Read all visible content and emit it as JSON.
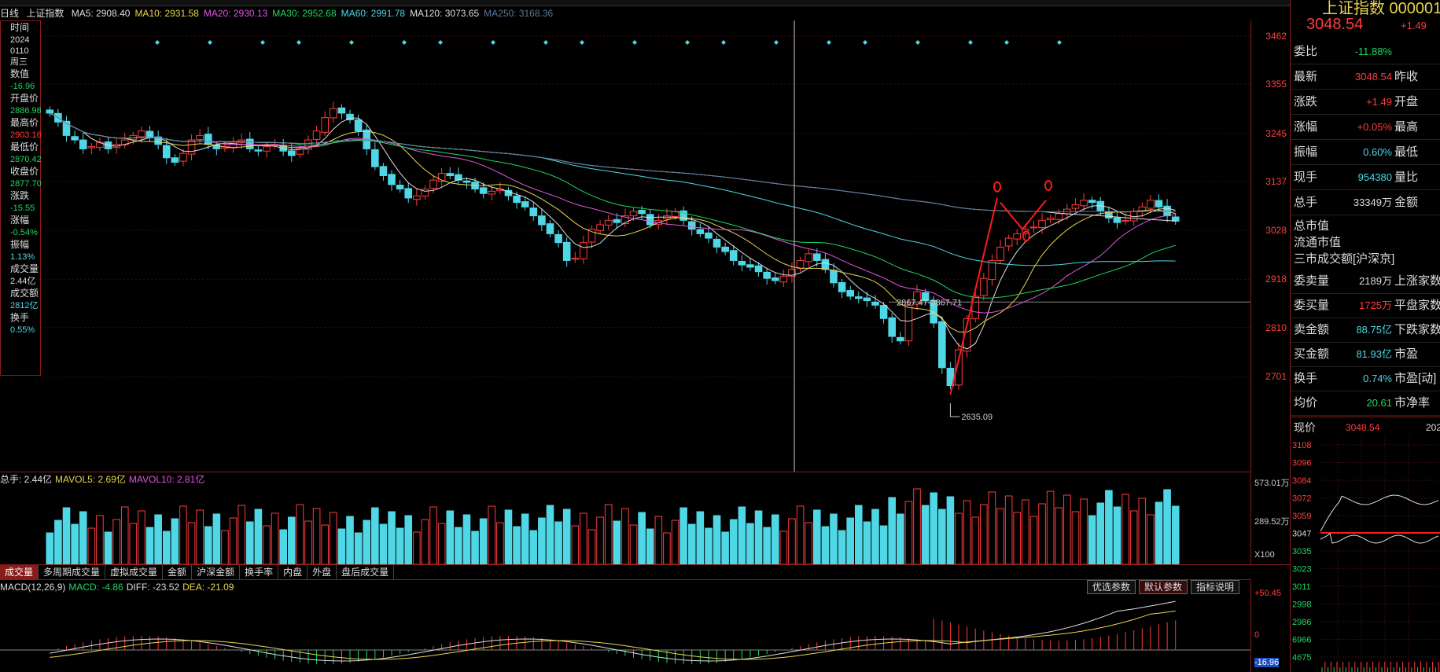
{
  "header": {
    "period": "日线",
    "index_name": "上证指数",
    "ma_items": [
      {
        "label": "MA5: 2908.40",
        "color": "#dddddd"
      },
      {
        "label": "MA10: 2931.58",
        "color": "#e8d44d"
      },
      {
        "label": "MA20: 2930.13",
        "color": "#e055e0"
      },
      {
        "label": "MA30: 2952.68",
        "color": "#1ed760"
      },
      {
        "label": "MA60: 2991.78",
        "color": "#4fd7e6"
      },
      {
        "label": "MA120: 3073.65",
        "color": "#dddddd"
      },
      {
        "label": "MA250: 3168.36",
        "color": "#5a7a9a"
      }
    ]
  },
  "left_panel": {
    "items": [
      {
        "label": "时间",
        "value": "2024",
        "value2": "0110",
        "value3": "周三",
        "color": "#dddddd"
      },
      {
        "label": "数值",
        "value": "-16.96",
        "color": "#1ed760"
      },
      {
        "label": "开盘价",
        "value": "2886.98",
        "color": "#1ed760"
      },
      {
        "label": "最高价",
        "value": "2903.16",
        "color": "#ff3b3b"
      },
      {
        "label": "最低价",
        "value": "2870.42",
        "color": "#1ed760"
      },
      {
        "label": "收盘价",
        "value": "2877.70",
        "color": "#1ed760"
      },
      {
        "label": "涨跌",
        "value": "-15.55",
        "color": "#1ed760"
      },
      {
        "label": "涨幅",
        "value": "-0.54%",
        "color": "#1ed760"
      },
      {
        "label": "振幅",
        "value": "1.13%",
        "color": "#4fd7e6"
      },
      {
        "label": "成交量",
        "value": "2.44亿",
        "color": "#dddddd"
      },
      {
        "label": "成交额",
        "value": "2812亿",
        "color": "#4fd7e6"
      },
      {
        "label": "换手",
        "value": "0.55%",
        "color": "#4fd7e6"
      }
    ]
  },
  "price_axis": [
    "3462",
    "3355",
    "3245",
    "3137",
    "3028",
    "2918",
    "2810",
    "2701"
  ],
  "annotations": {
    "low_label": "2635.09",
    "crosshair_label": "2867.47-2867.71"
  },
  "volume": {
    "header": [
      {
        "label": "总手: 2.44亿",
        "color": "#dddddd"
      },
      {
        "label": "MAVOL5: 2.69亿",
        "color": "#e8d44d"
      },
      {
        "label": "MAVOL10: 2.81亿",
        "color": "#e055e0"
      }
    ],
    "axis": [
      "573.01万",
      "289.52万",
      "X100"
    ]
  },
  "tabs": [
    "成交量",
    "多周期成交量",
    "虚拟成交量",
    "金额",
    "沪深金额",
    "换手率",
    "内盘",
    "外盘",
    "盘后成交量"
  ],
  "macd": {
    "header": [
      {
        "label": "MACD(12,26,9)",
        "color": "#dddddd"
      },
      {
        "label": "MACD: -4.86",
        "color": "#1ed760"
      },
      {
        "label": "DIFF: -23.52",
        "color": "#dddddd"
      },
      {
        "label": "DEA: -21.09",
        "color": "#e8d44d"
      }
    ],
    "buttons": [
      "优选参数",
      "默认参数",
      "指标说明"
    ],
    "axis": [
      "+50.45",
      "0",
      "-16.96"
    ]
  },
  "right_panel": {
    "title": "上证指数 000001",
    "price": "3048.54",
    "change": "+1.49",
    "rows": [
      {
        "label": "委比",
        "value": "-11.88%",
        "color": "#1ed760",
        "label2": ""
      },
      {
        "label": "最新",
        "value": "3048.54",
        "color": "#ff3b3b",
        "label2": "昨收"
      },
      {
        "label": "涨跌",
        "value": "+1.49",
        "color": "#ff3b3b",
        "label2": "开盘"
      },
      {
        "label": "涨幅",
        "value": "+0.05%",
        "color": "#ff3b3b",
        "label2": "最高"
      },
      {
        "label": "振幅",
        "value": "0.60%",
        "color": "#4fd7e6",
        "label2": "最低"
      },
      {
        "label": "现手",
        "value": "954380",
        "color": "#4fd7e6",
        "label2": "量比"
      },
      {
        "label": "总手",
        "value": "33349万",
        "color": "#dddddd",
        "label2": "金额"
      }
    ],
    "plain_rows": [
      "总市值",
      "流通市值",
      "三市成交额[沪深京]"
    ],
    "rows2": [
      {
        "label": "委卖量",
        "value": "2189万",
        "color": "#dddddd",
        "label2": "上涨家数"
      },
      {
        "label": "委买量",
        "value": "1725万",
        "color": "#ff3b3b",
        "label2": "平盘家数"
      },
      {
        "label": "卖金额",
        "value": "88.75亿",
        "color": "#4fd7e6",
        "label2": "下跌家数"
      },
      {
        "label": "买金额",
        "value": "81.93亿",
        "color": "#4fd7e6",
        "label2": "市盈"
      },
      {
        "label": "换手",
        "value": "0.74%",
        "color": "#4fd7e6",
        "label2": "市盈[动]"
      },
      {
        "label": "均价",
        "value": "20.61",
        "color": "#1ed760",
        "label2": "市净率"
      }
    ],
    "xianjia": {
      "label": "现价",
      "value": "3048.54",
      "suffix": "202"
    },
    "mini_axis": [
      "3108",
      "3096",
      "3084",
      "3072",
      "3059",
      "3047",
      "3035",
      "3023",
      "3011",
      "2998",
      "2986",
      "6966",
      "4675"
    ]
  },
  "chart_data": {
    "type": "candlestick",
    "ylim": [
      2600,
      3480
    ],
    "closes": [
      3290,
      3270,
      3240,
      3230,
      3210,
      3215,
      3225,
      3210,
      3220,
      3230,
      3240,
      3250,
      3235,
      3220,
      3190,
      3180,
      3200,
      3230,
      3240,
      3220,
      3210,
      3215,
      3225,
      3230,
      3210,
      3205,
      3215,
      3220,
      3205,
      3195,
      3210,
      3230,
      3250,
      3280,
      3300,
      3290,
      3275,
      3250,
      3210,
      3170,
      3150,
      3130,
      3120,
      3100,
      3105,
      3120,
      3140,
      3155,
      3150,
      3140,
      3135,
      3120,
      3110,
      3115,
      3120,
      3105,
      3090,
      3080,
      3060,
      3040,
      3020,
      3000,
      2960,
      2965,
      3000,
      3030,
      3040,
      3050,
      3045,
      3060,
      3070,
      3065,
      3040,
      3050,
      3060,
      3070,
      3050,
      3030,
      3020,
      3010,
      2990,
      2980,
      2960,
      2950,
      2945,
      2935,
      2920,
      2915,
      2925,
      2940,
      2960,
      2975,
      2960,
      2940,
      2910,
      2890,
      2880,
      2875,
      2870,
      2860,
      2830,
      2790,
      2780,
      2860,
      2890,
      2870,
      2820,
      2720,
      2680,
      2760,
      2830,
      2880,
      2920,
      2960,
      2990,
      3010,
      3020,
      3030,
      3035,
      3050,
      3055,
      3065,
      3075,
      3085,
      3095,
      3090,
      3070,
      3055,
      3045,
      3050,
      3070,
      3080,
      3095,
      3080,
      3060,
      3048
    ]
  }
}
